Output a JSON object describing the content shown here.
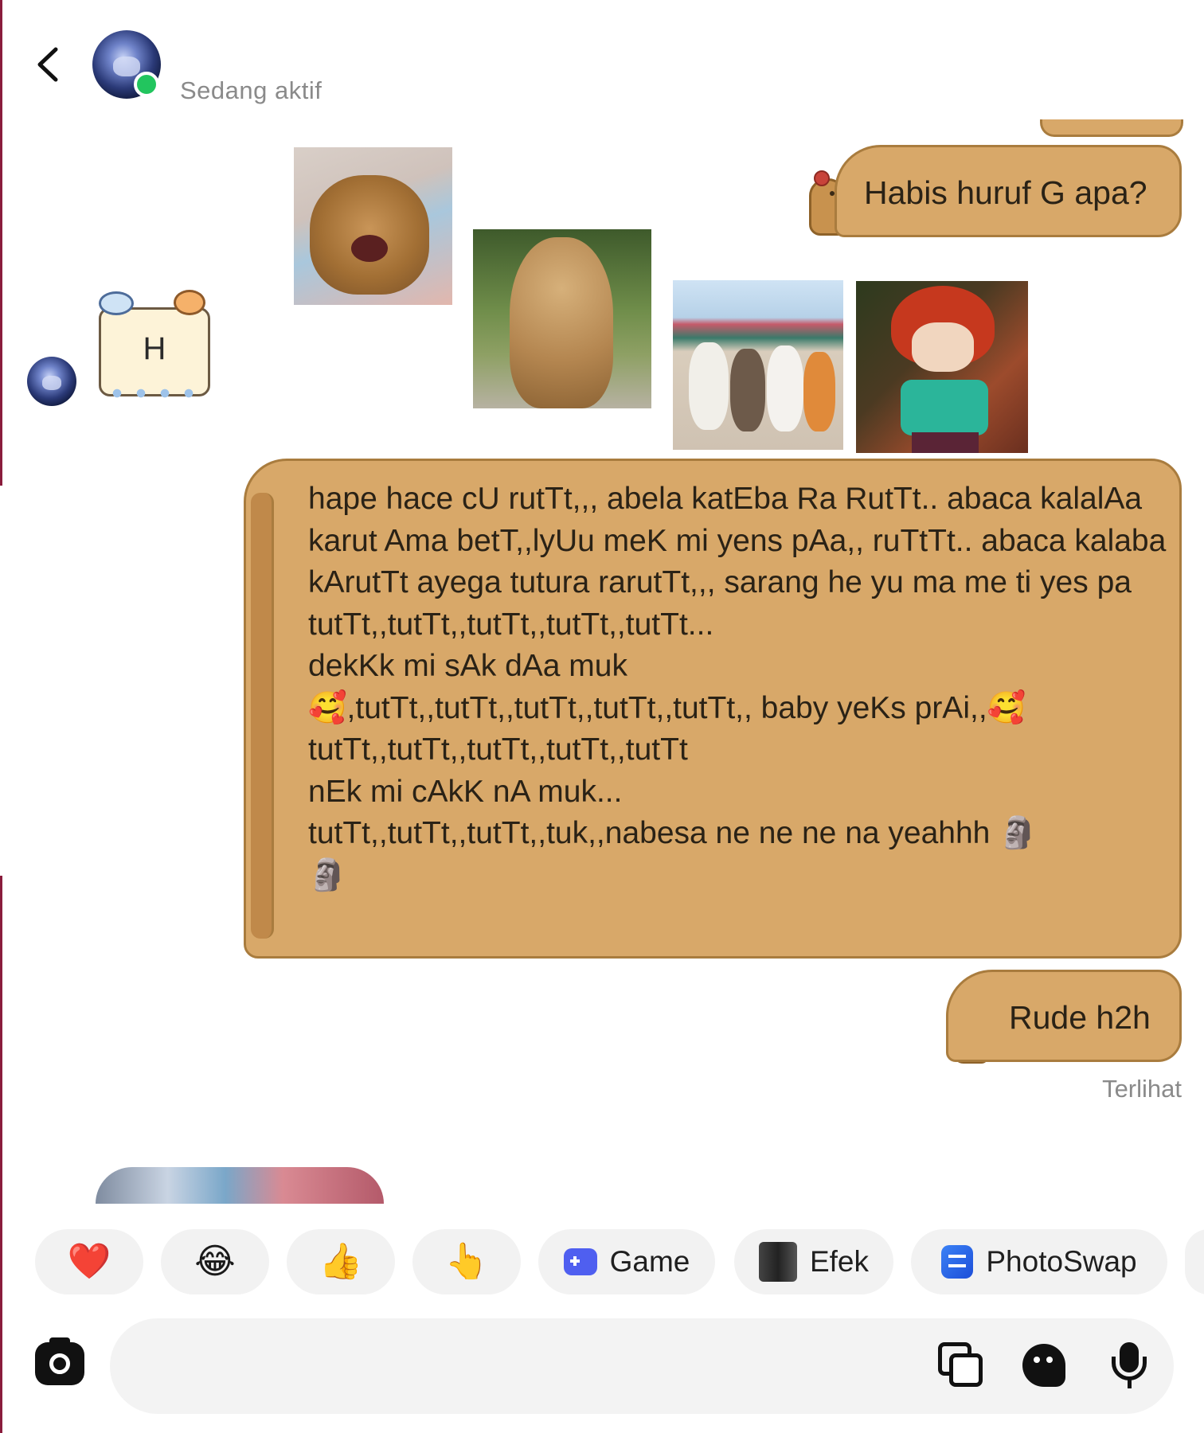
{
  "header": {
    "status": "Sedang aktif"
  },
  "messages": {
    "outgoing_1": "Habis huruf G apa?",
    "incoming_sticker_letter": "H",
    "outgoing_long": "hape hace cU rutTt,,, abela katEba Ra RutTt.. abaca kalalAa karut Ama betT,,lyUu meK mi yens pAa,, ruTtTt.. abaca kalaba kArutTt ayega tutura rarutTt,,, sarang he yu ma me ti yes pa\ntutTt,,tutTt,,tutTt,,tutTt,,tutTt...\ndekKk mi sAk dAa muk\n🥰,tutTt,,tutTt,,tutTt,,tutTt,,tutTt,, baby yeKs prAi,,🥰\ntutTt,,tutTt,,tutTt,,tutTt,,tutTt\nnEk mi cAkK nA muk...\ntutTt,,tutTt,,tutTt,,tuk,,nabesa ne ne ne na yeahhh 🗿\n🗿",
    "outgoing_last": "Rude h2h",
    "seen_label": "Terlihat"
  },
  "quick_actions": [
    {
      "emoji": "❤️"
    },
    {
      "emoji": "😂"
    },
    {
      "emoji": "👍"
    },
    {
      "emoji": "👆"
    },
    {
      "label": "Game",
      "icon": "game-controller-icon"
    },
    {
      "label": "Efek",
      "icon": "effects-icon"
    },
    {
      "label": "PhotoSwap",
      "icon": "photoswap-icon"
    }
  ],
  "composer": {
    "placeholder": ""
  },
  "colors": {
    "bubble_fill": "#d8a869",
    "bubble_border": "#a97c3e",
    "online": "#22c55e"
  }
}
